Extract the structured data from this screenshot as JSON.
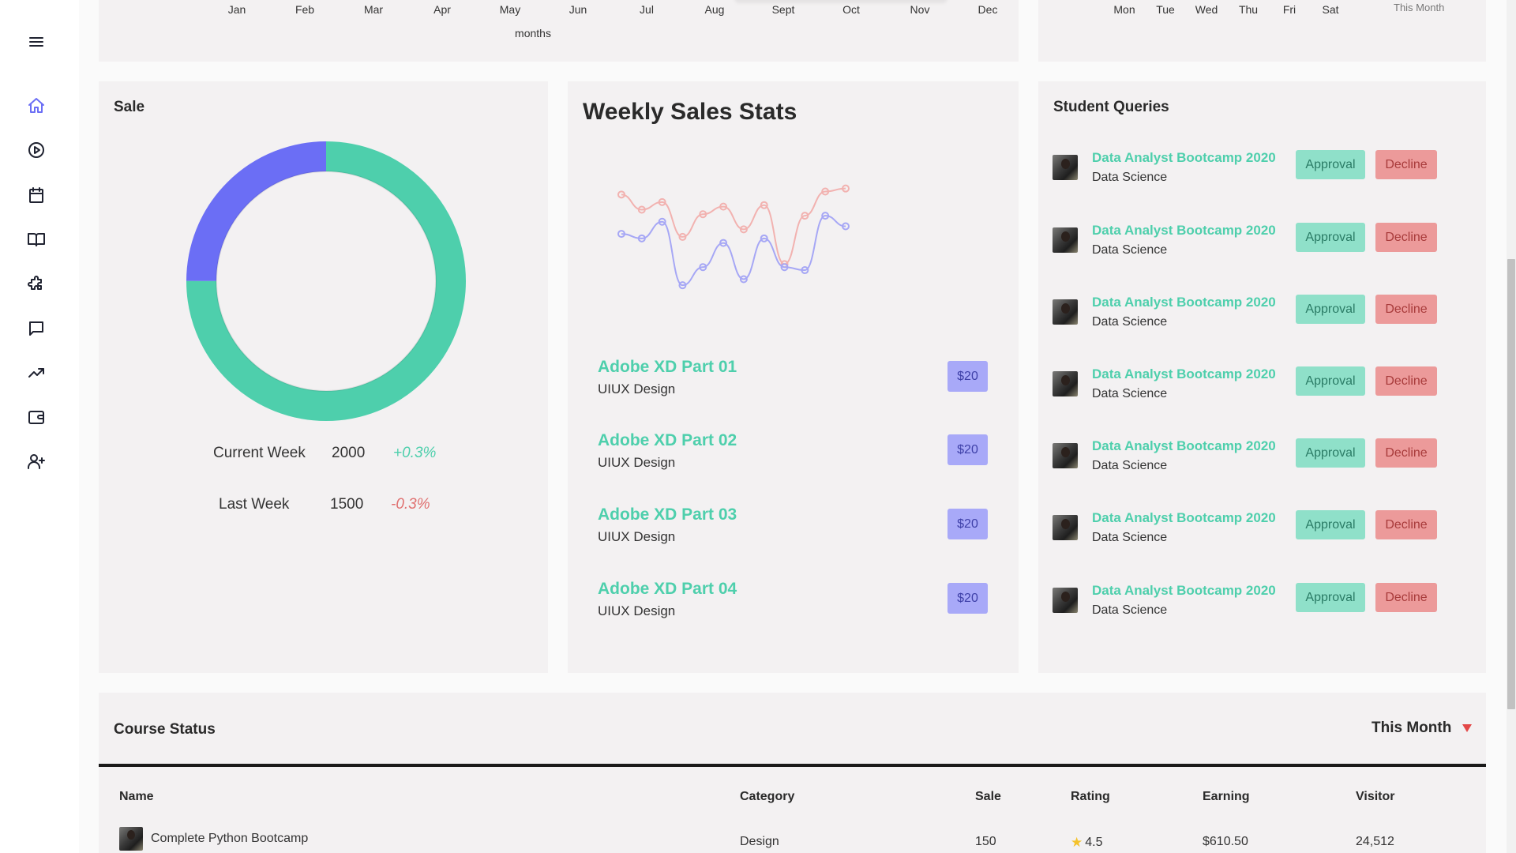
{
  "sidebar": {
    "items": [
      {
        "name": "menu",
        "icon": "menu-icon"
      },
      {
        "name": "home",
        "icon": "home-icon",
        "active": true
      },
      {
        "name": "play",
        "icon": "play-icon"
      },
      {
        "name": "calendar",
        "icon": "calendar-icon"
      },
      {
        "name": "book",
        "icon": "book-icon"
      },
      {
        "name": "puzzle",
        "icon": "puzzle-icon"
      },
      {
        "name": "messages",
        "icon": "message-icon"
      },
      {
        "name": "trending",
        "icon": "trending-up-icon"
      },
      {
        "name": "wallet",
        "icon": "wallet-icon"
      },
      {
        "name": "add-user",
        "icon": "user-plus-icon"
      }
    ]
  },
  "top_chart": {
    "months": [
      "Jan",
      "Feb",
      "Mar",
      "Apr",
      "May",
      "Jun",
      "Jul",
      "Aug",
      "Sept",
      "Oct",
      "Nov",
      "Dec"
    ],
    "xlabel": "months"
  },
  "top_right_chart": {
    "days": [
      "Mon",
      "Tue",
      "Wed",
      "Thu",
      "Fri",
      "Sat"
    ],
    "range_label": "This Month"
  },
  "sale": {
    "title": "Sale",
    "rows": [
      {
        "label": "Current Week",
        "value": "2000",
        "change": "+0.3%",
        "trend": "up"
      },
      {
        "label": "Last Week",
        "value": "1500",
        "change": "-0.3%",
        "trend": "down"
      }
    ],
    "colors": {
      "primary": "#4ecfac",
      "secondary": "#6b6ef5"
    }
  },
  "chart_data": [
    {
      "type": "pie",
      "title": "",
      "values": [
        75,
        25
      ],
      "colors": [
        "#4ecfac",
        "#6b6ef5"
      ]
    },
    {
      "type": "line",
      "title": "",
      "x": [
        1,
        2,
        3,
        4,
        5,
        6,
        7,
        8,
        9,
        10,
        11,
        12
      ],
      "series": [
        {
          "color": "#f2b2b0",
          "values": [
            62,
            52,
            57,
            34,
            49,
            54,
            39,
            55,
            16,
            48,
            64,
            66
          ]
        },
        {
          "color": "#a6a7f5",
          "values": [
            36,
            33,
            44,
            2,
            14,
            30,
            6,
            33,
            14,
            12,
            48,
            41
          ]
        }
      ],
      "ylim": [
        0,
        70
      ]
    }
  ],
  "weekly": {
    "title": "Weekly Sales Stats",
    "courses": [
      {
        "name": "Adobe XD Part 01",
        "category": "UIUX Design",
        "price": "$20"
      },
      {
        "name": "Adobe XD Part 02",
        "category": "UIUX Design",
        "price": "$20"
      },
      {
        "name": "Adobe XD Part 03",
        "category": "UIUX Design",
        "price": "$20"
      },
      {
        "name": "Adobe XD Part 04",
        "category": "UIUX Design",
        "price": "$20"
      }
    ]
  },
  "queries": {
    "title": "Student Queries",
    "approve_label": "Approval",
    "decline_label": "Decline",
    "items": [
      {
        "title": "Data Analyst Bootcamp 2020",
        "subtitle": "Data Science"
      },
      {
        "title": "Data Analyst Bootcamp 2020",
        "subtitle": "Data Science"
      },
      {
        "title": "Data Analyst Bootcamp 2020",
        "subtitle": "Data Science"
      },
      {
        "title": "Data Analyst Bootcamp 2020",
        "subtitle": "Data Science"
      },
      {
        "title": "Data Analyst Bootcamp 2020",
        "subtitle": "Data Science"
      },
      {
        "title": "Data Analyst Bootcamp 2020",
        "subtitle": "Data Science"
      },
      {
        "title": "Data Analyst Bootcamp 2020",
        "subtitle": "Data Science"
      }
    ]
  },
  "course_status": {
    "title": "Course Status",
    "period": "This Month",
    "columns": [
      "Name",
      "Category",
      "Sale",
      "Rating",
      "Earning",
      "Visitor"
    ],
    "rows": [
      {
        "name": "Complete Python Bootcamp",
        "category": "Design",
        "sale": "150",
        "rating": "4.5",
        "earning": "$610.50",
        "visitor": "24,512"
      }
    ]
  }
}
